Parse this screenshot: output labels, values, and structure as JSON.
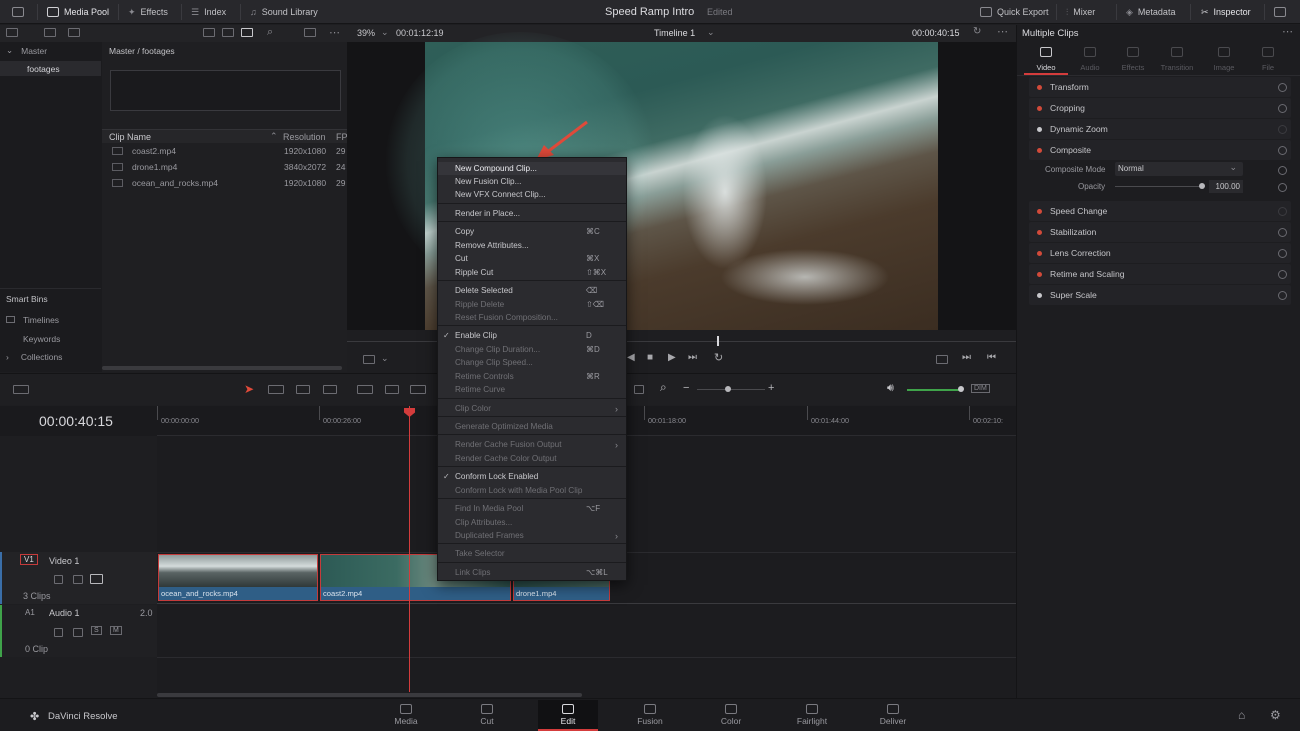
{
  "top": {
    "media_pool": "Media Pool",
    "effects": "Effects",
    "index": "Index",
    "sound_library": "Sound Library",
    "project_title": "Speed Ramp Intro",
    "project_status": "Edited",
    "quick_export": "Quick Export",
    "mixer": "Mixer",
    "metadata": "Metadata",
    "inspector": "Inspector"
  },
  "viewer": {
    "zoom": "39%",
    "source_tc": "00:01:12:19",
    "timeline_name": "Timeline 1",
    "record_tc": "00:00:40:15"
  },
  "media_pool": {
    "bin_master": "Master",
    "bin_footages": "footages",
    "breadcrumb": "Master / footages",
    "col_clip_name": "Clip Name",
    "col_resolution": "Resolution",
    "col_fps": "FPS",
    "clips": [
      {
        "name": "coast2.mp4",
        "res": "1920x1080",
        "fps": "29"
      },
      {
        "name": "drone1.mp4",
        "res": "3840x2072",
        "fps": "24"
      },
      {
        "name": "ocean_and_rocks.mp4",
        "res": "1920x1080",
        "fps": "29"
      }
    ],
    "smart_bins": "Smart Bins",
    "timelines": "Timelines",
    "keywords": "Keywords",
    "collections": "Collections"
  },
  "inspector": {
    "title": "Multiple Clips",
    "tabs": [
      "Video",
      "Audio",
      "Effects",
      "Transition",
      "Image",
      "File"
    ],
    "sections": [
      "Transform",
      "Cropping",
      "Dynamic Zoom",
      "Composite"
    ],
    "composite_mode_label": "Composite Mode",
    "composite_mode_value": "Normal",
    "opacity_label": "Opacity",
    "opacity_value": "100.00",
    "sections2": [
      "Speed Change",
      "Stabilization",
      "Lens Correction",
      "Retime and Scaling",
      "Super Scale"
    ]
  },
  "context_menu": {
    "items": [
      "New Compound Clip...",
      "New Fusion Clip...",
      "New VFX Connect Clip...",
      "Render in Place...",
      "Copy",
      "Remove Attributes...",
      "Cut",
      "Ripple Cut",
      "Delete Selected",
      "Ripple Delete",
      "Reset Fusion Composition...",
      "Enable Clip",
      "Change Clip Duration...",
      "Change Clip Speed...",
      "Retime Controls",
      "Retime Curve",
      "Clip Color",
      "Generate Optimized Media",
      "Render Cache Fusion Output",
      "Render Cache Color Output",
      "Conform Lock Enabled",
      "Conform Lock with Media Pool Clip",
      "Find In Media Pool",
      "Clip Attributes...",
      "Duplicated Frames",
      "Take Selector",
      "Link Clips"
    ],
    "shortcuts": {
      "copy": "⌘C",
      "cut": "⌘X",
      "ripple_cut": "⇧⌘X",
      "delete_selected": "⌫",
      "ripple_delete": "⇧⌫",
      "enable_clip": "D",
      "change_duration": "⌘D",
      "retime_controls": "⌘R",
      "find_in_media_pool": "⌥F",
      "link_clips": "⌥⌘L"
    }
  },
  "timeline": {
    "timecode": "00:00:40:15",
    "ruler": [
      "00:00:00:00",
      "00:00:26:00",
      "00:01:18:00",
      "00:01:44:00",
      "00:02:10:"
    ],
    "v1_tag": "V1",
    "v1_name": "Video 1",
    "v1_count": "3 Clips",
    "a1_tag": "A1",
    "a1_name": "Audio 1",
    "a1_level": "2.0",
    "a1_count": "0 Clip",
    "clips": [
      "ocean_and_rocks.mp4",
      "coast2.mp4",
      "drone1.mp4"
    ],
    "dim": "DIM",
    "s": "S",
    "m": "M"
  },
  "pages": [
    "Media",
    "Cut",
    "Edit",
    "Fusion",
    "Color",
    "Fairlight",
    "Deliver"
  ],
  "brand": "DaVinci Resolve"
}
